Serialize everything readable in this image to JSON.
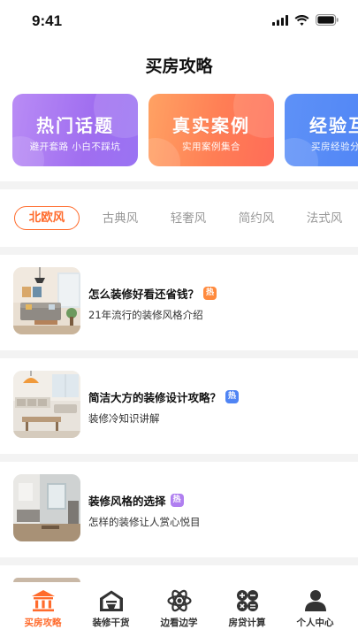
{
  "status_bar": {
    "time": "9:41"
  },
  "page": {
    "title": "买房攻略"
  },
  "banners": [
    {
      "title": "热门话题",
      "subtitle": "避开套路  小白不踩坑"
    },
    {
      "title": "真实案例",
      "subtitle": "实用案例集合"
    },
    {
      "title": "经验互",
      "subtitle": "买房经验分"
    }
  ],
  "style_tabs": [
    {
      "label": "北欧风",
      "active": true
    },
    {
      "label": "古典风"
    },
    {
      "label": "轻奢风"
    },
    {
      "label": "简约风"
    },
    {
      "label": "法式风"
    }
  ],
  "articles": [
    {
      "title": "怎么装修好看还省钱？",
      "badge": "热",
      "badge_color": "#ff8a3d",
      "subtitle": "21年流行的装修风格介绍"
    },
    {
      "title": "简洁大方的装修设计攻略？",
      "badge": "热",
      "badge_color": "#4f84f4",
      "subtitle": "装修冷知识讲解"
    },
    {
      "title": "装修风格的选择",
      "badge": "热",
      "badge_color": "#b07ff0",
      "subtitle": "怎样的装修让人赏心悦目"
    }
  ],
  "tabbar": [
    {
      "label": "买房攻略",
      "icon": "building-columns-icon",
      "active": true
    },
    {
      "label": "装修干货",
      "icon": "house-icon"
    },
    {
      "label": "边看边学",
      "icon": "atom-icon"
    },
    {
      "label": "房贷计算",
      "icon": "calculator-icon"
    },
    {
      "label": "个人中心",
      "icon": "person-icon"
    }
  ],
  "colors": {
    "accent": "#ff6b2c",
    "band": "#f3f3f3"
  }
}
